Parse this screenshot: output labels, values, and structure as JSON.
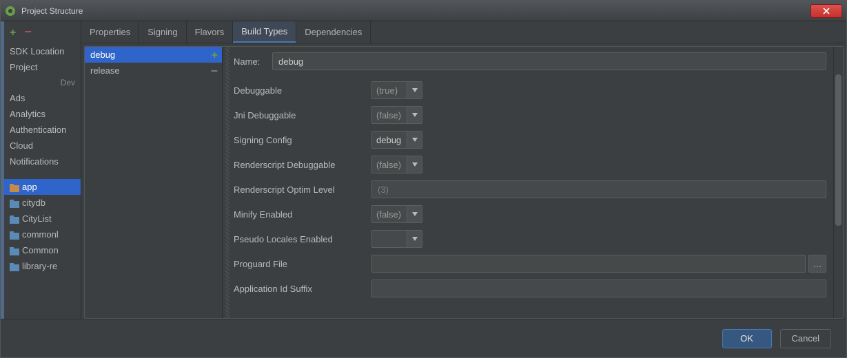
{
  "window": {
    "title": "Project Structure"
  },
  "sidebar": {
    "top_items": [
      "SDK Location",
      "Project"
    ],
    "section": "Dev",
    "dev_items": [
      "Ads",
      "Analytics",
      "Authentication",
      "Cloud",
      "Notifications"
    ],
    "modules": [
      {
        "label": "app",
        "selected": true
      },
      {
        "label": "citydb",
        "selected": false
      },
      {
        "label": "CityList",
        "selected": false
      },
      {
        "label": "commonl",
        "selected": false
      },
      {
        "label": "Common",
        "selected": false
      },
      {
        "label": "library-re",
        "selected": false
      }
    ]
  },
  "tabs": [
    "Properties",
    "Signing",
    "Flavors",
    "Build Types",
    "Dependencies"
  ],
  "active_tab": "Build Types",
  "types": [
    {
      "label": "debug",
      "selected": true
    },
    {
      "label": "release",
      "selected": false
    }
  ],
  "form": {
    "name_label": "Name:",
    "name_value": "debug",
    "rows": [
      {
        "label": "Debuggable",
        "value": "(true)",
        "filled": false,
        "type": "combo"
      },
      {
        "label": "Jni Debuggable",
        "value": "(false)",
        "filled": false,
        "type": "combo"
      },
      {
        "label": "Signing Config",
        "value": "debug",
        "filled": true,
        "type": "combo"
      },
      {
        "label": "Renderscript Debuggable",
        "value": "(false)",
        "filled": false,
        "type": "combo"
      },
      {
        "label": "Renderscript Optim Level",
        "value": "",
        "placeholder": "(3)",
        "type": "text"
      },
      {
        "label": "Minify Enabled",
        "value": "(false)",
        "filled": false,
        "type": "combo"
      },
      {
        "label": "Pseudo Locales Enabled",
        "value": "",
        "filled": false,
        "type": "combo"
      },
      {
        "label": "Proguard File",
        "value": "",
        "type": "text-browse"
      },
      {
        "label": "Application Id Suffix",
        "value": "",
        "type": "text"
      }
    ]
  },
  "footer": {
    "ok": "OK",
    "cancel": "Cancel"
  },
  "browse": "…"
}
